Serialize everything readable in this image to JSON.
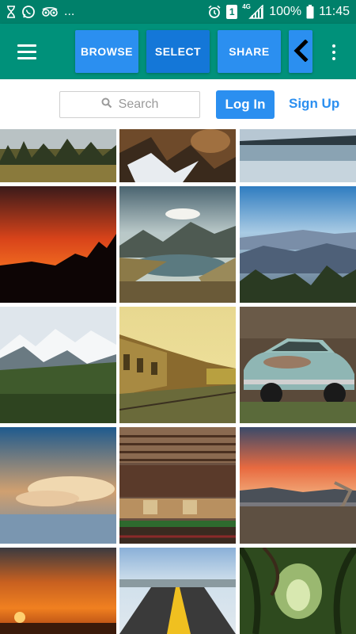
{
  "status_bar": {
    "battery": "100%",
    "time": "11:45",
    "network": "4G",
    "sim_label": "1",
    "notification_more": "..."
  },
  "toolbar": {
    "browse_label": "BROWSE",
    "select_label": "SELECT",
    "share_label": "SHARE"
  },
  "search": {
    "placeholder": "Search"
  },
  "auth": {
    "login_label": "Log In",
    "signup_label": "Sign Up"
  },
  "colors": {
    "status_bar": "#00806a",
    "toolbar": "#00917a",
    "button": "#2b8ff0",
    "button_active": "#1477d8"
  },
  "gallery": {
    "photos": [
      "forest-meadow",
      "rocky-snow-slope",
      "mountain-lake-reflection",
      "red-sunset-silhouette",
      "mountain-lake-clouds",
      "blue-mountain-valley",
      "snowy-mountain-range",
      "old-train-station",
      "rusty-vintage-car",
      "cloud-over-sea",
      "railway-freight-cars",
      "sunset-plains",
      "orange-sunset-water",
      "road-yellow-line",
      "green-tree-tunnel"
    ]
  }
}
